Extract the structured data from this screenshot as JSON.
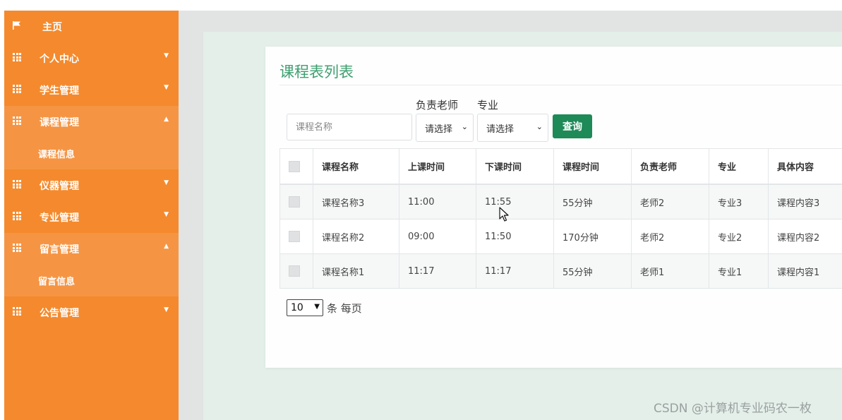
{
  "sidebar": {
    "items": [
      {
        "label": "主页",
        "icon": "flag-icon"
      },
      {
        "label": "个人中心",
        "icon": "grid-icon"
      },
      {
        "label": "学生管理",
        "icon": "grid-icon"
      },
      {
        "label": "课程管理",
        "icon": "grid-icon",
        "expanded": true,
        "sub": "课程信息"
      },
      {
        "label": "仪器管理",
        "icon": "grid-icon"
      },
      {
        "label": "专业管理",
        "icon": "grid-icon"
      },
      {
        "label": "留言管理",
        "icon": "grid-icon",
        "expanded": true,
        "sub": "留言信息"
      },
      {
        "label": "公告管理",
        "icon": "grid-icon"
      }
    ]
  },
  "panel": {
    "title": "课程表列表"
  },
  "search": {
    "placeholder": "课程名称",
    "teacher_label": "负责老师",
    "teacher_value": "请选择",
    "major_label": "专业",
    "major_value": "请选择",
    "query_label": "查询"
  },
  "table": {
    "headers": [
      "课程名称",
      "上课时间",
      "下课时间",
      "课程时间",
      "负责老师",
      "专业",
      "具体内容"
    ],
    "rows": [
      [
        "课程名称3",
        "11:00",
        "11:55",
        "55分钟",
        "老师2",
        "专业3",
        "课程内容3"
      ],
      [
        "课程名称2",
        "09:00",
        "11:50",
        "170分钟",
        "老师2",
        "专业2",
        "课程内容2"
      ],
      [
        "课程名称1",
        "11:17",
        "11:17",
        "55分钟",
        "老师1",
        "专业1",
        "课程内容1"
      ]
    ]
  },
  "pager": {
    "size": "10",
    "suffix": "条 每页"
  },
  "watermark": "CSDN @计算机专业码农一枚",
  "colors": {
    "sidebar": "#f48a2d",
    "accent": "#3e9f70",
    "button": "#1e8a58"
  }
}
